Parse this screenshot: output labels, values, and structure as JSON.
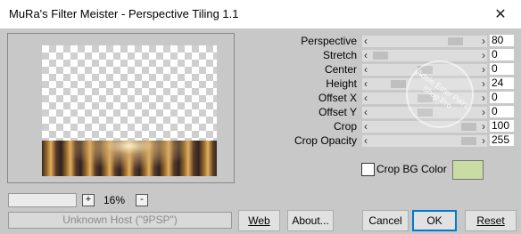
{
  "window": {
    "title": "MuRa's Filter Meister - Perspective Tiling 1.1",
    "close_glyph": "✕"
  },
  "preview": {
    "zoom_minus": "-",
    "zoom_plus": "+",
    "zoom_value": "16%",
    "status_text": "Unknown Host (\"9PSP\")"
  },
  "parameters": [
    {
      "label": "Perspective",
      "value": "80",
      "level": 0.85
    },
    {
      "label": "Stretch",
      "value": "0",
      "level": 0.0
    },
    {
      "label": "Center",
      "value": "0",
      "level": 0.5
    },
    {
      "label": "Height",
      "value": "24",
      "level": 0.2
    },
    {
      "label": "Offset X",
      "value": "0",
      "level": 0.5
    },
    {
      "label": "Offset Y",
      "value": "0",
      "level": 0.5
    },
    {
      "label": "Crop",
      "value": "100",
      "level": 1.0
    },
    {
      "label": "Crop Opacity",
      "value": "255",
      "level": 1.0
    }
  ],
  "watermark": {
    "text": "Adele Ester Paint Shop Pro"
  },
  "crop_bg": {
    "label": "Crop BG Color",
    "checked": false,
    "color": "#c8dca4"
  },
  "buttons": {
    "web": "Web",
    "about": "About...",
    "cancel": "Cancel",
    "ok": "OK",
    "reset": "Reset"
  }
}
